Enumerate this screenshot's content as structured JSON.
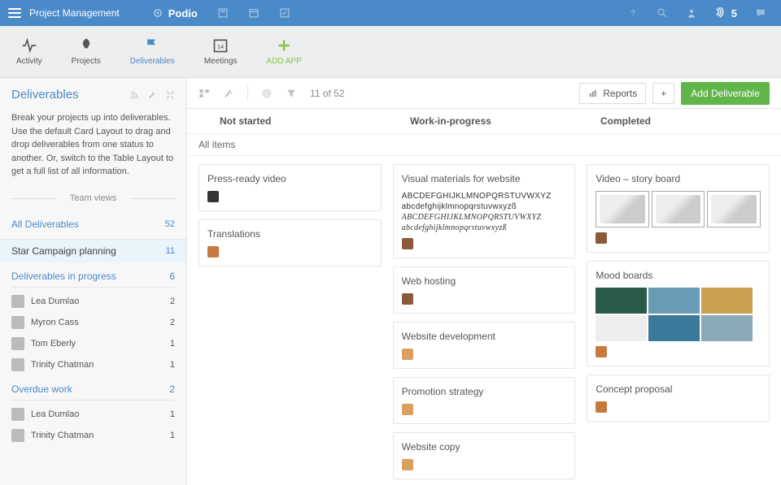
{
  "topbar": {
    "workspace": "Project Management",
    "brand": "Podio",
    "notifications_count": "5"
  },
  "appbar": {
    "activity": "Activity",
    "projects": "Projects",
    "deliverables": "Deliverables",
    "meetings": "Meetings",
    "add_app": "ADD APP"
  },
  "sidebar": {
    "title": "Deliverables",
    "description": "Break your projects up into deliverables. Use the default Card Layout to drag and drop deliverables from one status to another. Or, switch to the Table Layout to get a full list of all information.",
    "team_views_label": "Team views",
    "views": [
      {
        "label": "All Deliverables",
        "count": "52"
      },
      {
        "label": "Star Campaign planning",
        "count": "11"
      }
    ],
    "in_progress": {
      "title": "Deliverables in progress",
      "count": "6",
      "people": [
        {
          "name": "Lea Dumlao",
          "count": "2"
        },
        {
          "name": "Myron Cass",
          "count": "2"
        },
        {
          "name": "Tom Eberly",
          "count": "1"
        },
        {
          "name": "Trinity Chatman",
          "count": "1"
        }
      ]
    },
    "overdue": {
      "title": "Overdue work",
      "count": "2",
      "people": [
        {
          "name": "Lea Dumlao",
          "count": "1"
        },
        {
          "name": "Trinity Chatman",
          "count": "1"
        }
      ]
    }
  },
  "toolbar": {
    "count_text": "11 of 52",
    "reports_label": "Reports",
    "plus_label": "+",
    "add_label": "Add Deliverable"
  },
  "kanban": {
    "all_items_label": "All items",
    "cols": [
      {
        "title": "Not started"
      },
      {
        "title": "Work-in-progress"
      },
      {
        "title": "Completed"
      }
    ],
    "not_started": [
      "Press-ready video",
      "Translations"
    ],
    "wip": [
      "Visual materials for website",
      "Web hosting",
      "Website development",
      "Promotion strategy",
      "Website copy"
    ],
    "completed": [
      "Video – story board",
      "Mood boards",
      "Concept proposal"
    ],
    "typography_sample": [
      "ABCDEFGHIJKLMNOPQRSTUVWXYZ",
      "abcdefghijklmnopqrstuvwxyzß",
      "ABCDEFGHIJKLMNOPQRSTUVWXYZ",
      "abcdefghijklmnopqrstuvwxyzß"
    ]
  }
}
